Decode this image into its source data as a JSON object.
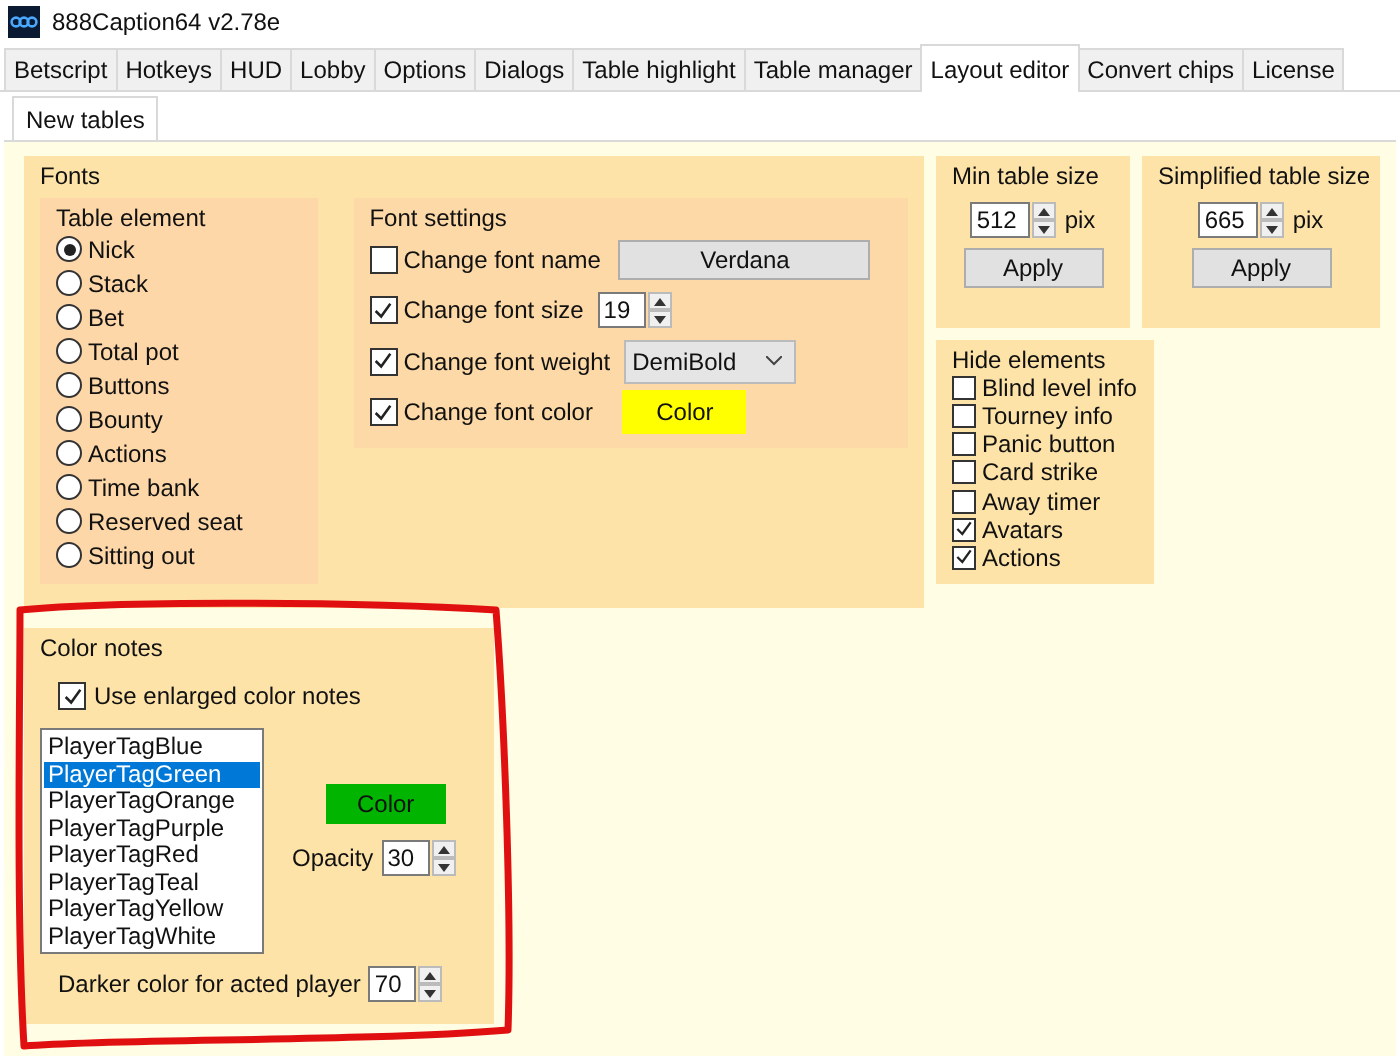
{
  "window": {
    "title": "888Caption64 v2.78e"
  },
  "tabs": [
    {
      "label": "Betscript",
      "selected": false
    },
    {
      "label": "Hotkeys",
      "selected": false
    },
    {
      "label": "HUD",
      "selected": false
    },
    {
      "label": "Lobby",
      "selected": false
    },
    {
      "label": "Options",
      "selected": false
    },
    {
      "label": "Dialogs",
      "selected": false
    },
    {
      "label": "Table highlight",
      "selected": false
    },
    {
      "label": "Table manager",
      "selected": false
    },
    {
      "label": "Layout editor",
      "selected": true
    },
    {
      "label": "Convert chips",
      "selected": false
    },
    {
      "label": "License",
      "selected": false
    }
  ],
  "subtabs": [
    {
      "label": "New tables",
      "selected": true
    }
  ],
  "fonts": {
    "title": "Fonts",
    "table_element": {
      "title": "Table element",
      "options": [
        {
          "label": "Nick",
          "selected": true
        },
        {
          "label": "Stack",
          "selected": false
        },
        {
          "label": "Bet",
          "selected": false
        },
        {
          "label": "Total pot",
          "selected": false
        },
        {
          "label": "Buttons",
          "selected": false
        },
        {
          "label": "Bounty",
          "selected": false
        },
        {
          "label": "Actions",
          "selected": false
        },
        {
          "label": "Time bank",
          "selected": false
        },
        {
          "label": "Reserved seat",
          "selected": false
        },
        {
          "label": "Sitting out",
          "selected": false
        }
      ]
    },
    "font_settings": {
      "title": "Font settings",
      "rows": [
        {
          "kind": "button",
          "label": "Change font name",
          "checked": false,
          "value": "Verdana"
        },
        {
          "kind": "spinner",
          "label": "Change font size",
          "checked": true,
          "value": "19"
        },
        {
          "kind": "dropdown",
          "label": "Change font weight",
          "checked": true,
          "value": "DemiBold"
        },
        {
          "kind": "color",
          "label": "Change font color",
          "checked": true,
          "value": "Color",
          "color": "#ffff00"
        }
      ]
    }
  },
  "sizes": [
    {
      "title": "Min table size",
      "value": "512",
      "unit": "pix",
      "button": "Apply"
    },
    {
      "title": "Simplified table size",
      "value": "665",
      "unit": "pix",
      "button": "Apply"
    }
  ],
  "hide_elements": {
    "title": "Hide elements",
    "items": [
      {
        "label": "Blind level info",
        "checked": false
      },
      {
        "label": "Tourney info",
        "checked": false
      },
      {
        "label": "Panic button",
        "checked": false
      },
      {
        "label": "Card strike",
        "checked": false
      },
      {
        "label": "Away timer",
        "checked": false
      },
      {
        "label": "Avatars",
        "checked": true
      },
      {
        "label": "Actions",
        "checked": true
      }
    ]
  },
  "color_notes": {
    "title": "Color notes",
    "enlarged": {
      "label": "Use enlarged color notes",
      "checked": true
    },
    "tags": [
      {
        "label": "PlayerTagBlue",
        "selected": false
      },
      {
        "label": "PlayerTagGreen",
        "selected": true
      },
      {
        "label": "PlayerTagOrange",
        "selected": false
      },
      {
        "label": "PlayerTagPurple",
        "selected": false
      },
      {
        "label": "PlayerTagRed",
        "selected": false
      },
      {
        "label": "PlayerTagTeal",
        "selected": false
      },
      {
        "label": "PlayerTagYellow",
        "selected": false
      },
      {
        "label": "PlayerTagWhite",
        "selected": false
      }
    ],
    "color_button": {
      "label": "Color",
      "color": "#00b400"
    },
    "opacity": {
      "label": "Opacity",
      "value": "30"
    },
    "darker": {
      "label": "Darker color for acted player",
      "value": "70"
    }
  }
}
